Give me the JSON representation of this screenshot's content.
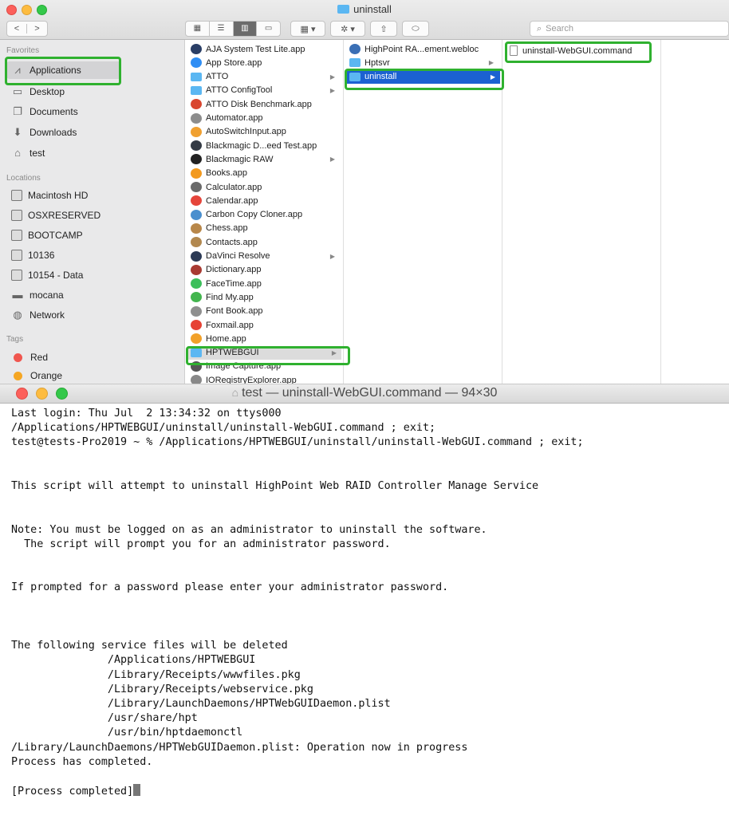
{
  "finder": {
    "window_title": "uninstall",
    "nav": {
      "back": "<",
      "forward": ">"
    },
    "search_placeholder": "Search",
    "sidebar": {
      "favorites_heading": "Favorites",
      "favorites": [
        {
          "label": "Applications",
          "icon": "applications-icon"
        },
        {
          "label": "Desktop",
          "icon": "desktop-icon"
        },
        {
          "label": "Documents",
          "icon": "documents-icon"
        },
        {
          "label": "Downloads",
          "icon": "downloads-icon"
        },
        {
          "label": "test",
          "icon": "home-icon"
        }
      ],
      "locations_heading": "Locations",
      "locations": [
        {
          "label": "Macintosh HD"
        },
        {
          "label": "OSXRESERVED"
        },
        {
          "label": "BOOTCAMP"
        },
        {
          "label": "10136"
        },
        {
          "label": "10154 - Data"
        },
        {
          "label": "mocana"
        },
        {
          "label": "Network"
        }
      ],
      "tags_heading": "Tags",
      "tags": [
        {
          "label": "Red",
          "color": "#f0564f"
        },
        {
          "label": "Orange",
          "color": "#f5a623"
        }
      ]
    },
    "column1": [
      {
        "label": "AJA System Test Lite.app",
        "color": "#2a3e66"
      },
      {
        "label": "App Store.app",
        "color": "#2f8ef4"
      },
      {
        "label": "ATTO",
        "folder": true,
        "arrow": true
      },
      {
        "label": "ATTO ConfigTool",
        "folder": true,
        "arrow": true
      },
      {
        "label": "ATTO Disk Benchmark.app",
        "color": "#d9462f"
      },
      {
        "label": "Automator.app",
        "color": "#8d8d8d"
      },
      {
        "label": "AutoSwitchInput.app",
        "color": "#f0a030"
      },
      {
        "label": "Blackmagic D...eed Test.app",
        "color": "#333a44"
      },
      {
        "label": "Blackmagic RAW",
        "color": "#222222",
        "arrow": true
      },
      {
        "label": "Books.app",
        "color": "#f39a1e"
      },
      {
        "label": "Calculator.app",
        "color": "#6a6a6a"
      },
      {
        "label": "Calendar.app",
        "color": "#e5453b"
      },
      {
        "label": "Carbon Copy Cloner.app",
        "color": "#4a8fce"
      },
      {
        "label": "Chess.app",
        "color": "#b8874a"
      },
      {
        "label": "Contacts.app",
        "color": "#b2884f"
      },
      {
        "label": "DaVinci Resolve",
        "color": "#2c3a55",
        "arrow": true
      },
      {
        "label": "Dictionary.app",
        "color": "#a83a32"
      },
      {
        "label": "FaceTime.app",
        "color": "#3cbf5b"
      },
      {
        "label": "Find My.app",
        "color": "#43b54e"
      },
      {
        "label": "Font Book.app",
        "color": "#8f8f8f"
      },
      {
        "label": "Foxmail.app",
        "color": "#e64234"
      },
      {
        "label": "Home.app",
        "color": "#f2a12a"
      },
      {
        "label": "HPTWEBGUI",
        "folder": true,
        "arrow": true,
        "highlight": true
      },
      {
        "label": "Image Capture.app",
        "color": "#555555"
      },
      {
        "label": "IORegistryExplorer.app",
        "color": "#888888"
      }
    ],
    "column2": [
      {
        "label": "HighPoint RA...ement.webloc",
        "color": "#3a6fb5"
      },
      {
        "label": "Hptsvr",
        "folder": true,
        "arrow": true
      },
      {
        "label": "uninstall",
        "folder": true,
        "arrow": true,
        "selected": true
      }
    ],
    "column3": [
      {
        "label": "uninstall-WebGUI.command",
        "doc": true
      }
    ]
  },
  "terminal": {
    "title_prefix": "test",
    "title": " — uninstall-WebGUI.command — 94×30",
    "lines": [
      "Last login: Thu Jul  2 13:34:32 on ttys000",
      "/Applications/HPTWEBGUI/uninstall/uninstall-WebGUI.command ; exit;",
      "test@tests-Pro2019 ~ % /Applications/HPTWEBGUI/uninstall/uninstall-WebGUI.command ; exit;",
      "",
      "",
      "This script will attempt to uninstall HighPoint Web RAID Controller Manage Service",
      "",
      "",
      "Note: You must be logged on as an administrator to uninstall the software.",
      "  The script will prompt you for an administrator password.",
      "",
      "",
      "If prompted for a password please enter your administrator password.",
      "",
      "",
      "",
      "The following service files will be deleted",
      "               /Applications/HPTWEBGUI",
      "               /Library/Receipts/wwwfiles.pkg",
      "               /Library/Receipts/webservice.pkg",
      "               /Library/LaunchDaemons/HPTWebGUIDaemon.plist",
      "               /usr/share/hpt",
      "               /usr/bin/hptdaemonctl",
      "/Library/LaunchDaemons/HPTWebGUIDaemon.plist: Operation now in progress",
      "Process has completed.",
      ""
    ],
    "last_line": "[Process completed]"
  }
}
